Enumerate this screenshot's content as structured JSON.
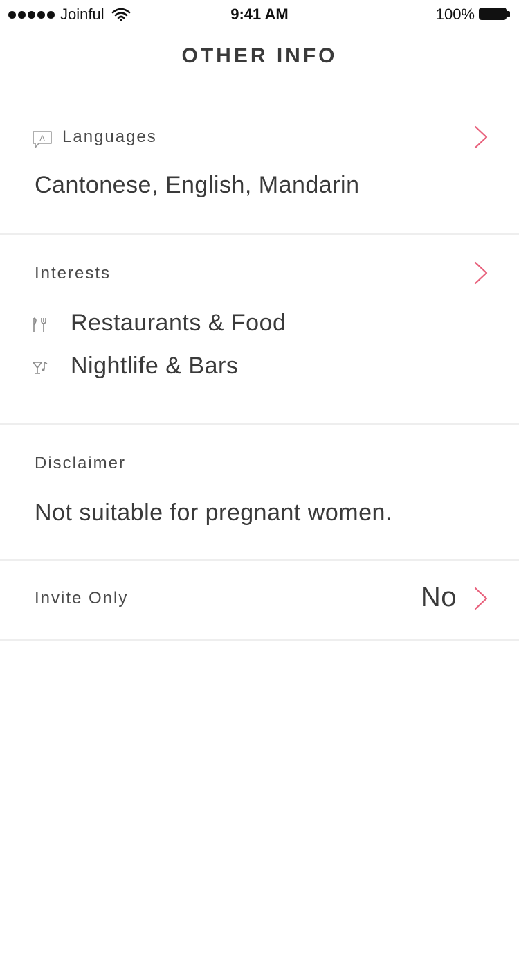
{
  "status_bar": {
    "carrier": "Joinful",
    "time": "9:41 AM",
    "battery": "100%"
  },
  "page": {
    "title": "OTHER INFO"
  },
  "languages": {
    "label": "Languages",
    "value": "Cantonese, English, Mandarin",
    "icon": "language-icon"
  },
  "interests": {
    "label": "Interests",
    "items": [
      {
        "label": "Restaurants & Food",
        "icon": "fork-knife-icon"
      },
      {
        "label": "Nightlife & Bars",
        "icon": "cocktail-icon"
      }
    ]
  },
  "disclaimer": {
    "label": "Disclaimer",
    "value": "Not suitable for pregnant women."
  },
  "invite_only": {
    "label": "Invite Only",
    "value": "No"
  },
  "colors": {
    "accent": "#e8617c",
    "text": "#3a3a3a",
    "divider": "#eeeeee"
  }
}
